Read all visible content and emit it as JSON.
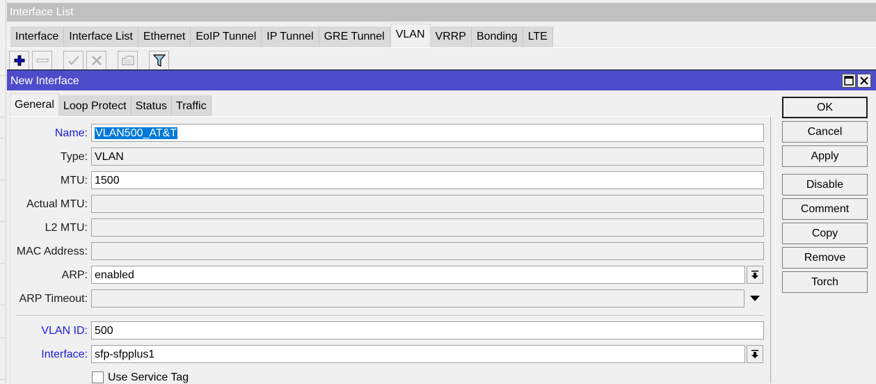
{
  "window": {
    "title": "Interface List"
  },
  "tabs": [
    "Interface",
    "Interface List",
    "Ethernet",
    "EoIP Tunnel",
    "IP Tunnel",
    "GRE Tunnel",
    "VLAN",
    "VRRP",
    "Bonding",
    "LTE"
  ],
  "active_tab": "VLAN",
  "toolbar": {
    "buttons": [
      {
        "icon": "plus-icon",
        "label": "Add"
      },
      {
        "icon": "minus-icon",
        "label": "Remove"
      },
      {
        "icon": "check-icon",
        "label": "Enable"
      },
      {
        "icon": "cross-icon",
        "label": "Disable"
      },
      {
        "icon": "comment-icon",
        "label": "Comment"
      },
      {
        "icon": "filter-icon",
        "label": "Filter"
      }
    ]
  },
  "dialog": {
    "title": "New Interface",
    "tabs": [
      "General",
      "Loop Protect",
      "Status",
      "Traffic"
    ],
    "active_tab": "General",
    "fields": {
      "name": {
        "label": "Name:",
        "value": "VLAN500_AT&T"
      },
      "type": {
        "label": "Type:",
        "value": "VLAN"
      },
      "mtu": {
        "label": "MTU:",
        "value": "1500"
      },
      "actual_mtu": {
        "label": "Actual MTU:",
        "value": ""
      },
      "l2_mtu": {
        "label": "L2 MTU:",
        "value": ""
      },
      "mac_address": {
        "label": "MAC Address:",
        "value": ""
      },
      "arp": {
        "label": "ARP:",
        "value": "enabled"
      },
      "arp_timeout": {
        "label": "ARP Timeout:",
        "value": ""
      },
      "vlan_id": {
        "label": "VLAN ID:",
        "value": "500"
      },
      "interface": {
        "label": "Interface:",
        "value": "sfp-sfpplus1"
      },
      "use_service_tag": {
        "label": "Use Service Tag",
        "checked": false
      }
    },
    "buttons": {
      "ok": "OK",
      "cancel": "Cancel",
      "apply": "Apply",
      "disable": "Disable",
      "comment": "Comment",
      "copy": "Copy",
      "remove": "Remove",
      "torch": "Torch"
    }
  },
  "colors": {
    "dialog_titlebar": "#4d4dcb",
    "list_titlebar": "#c0c0c0",
    "required_label": "#1b1bdb",
    "selection": "#0078d7"
  }
}
